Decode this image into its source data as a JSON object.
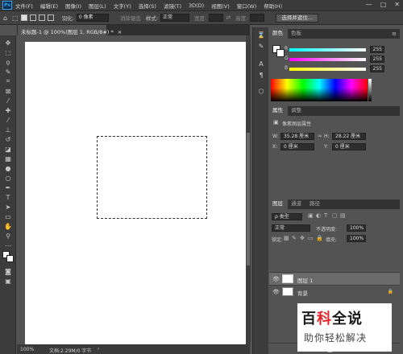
{
  "menubar": {
    "logo": "Ps",
    "items": [
      "文件(F)",
      "编辑(E)",
      "图像(I)",
      "图层(L)",
      "文字(Y)",
      "选择(S)",
      "滤镜(T)",
      "3D(D)",
      "视图(V)",
      "窗口(W)",
      "帮助(H)"
    ],
    "window_buttons": [
      "—",
      "□",
      "✕"
    ]
  },
  "options_bar": {
    "feather_label": "羽化:",
    "feather_value": "0 像素",
    "antialias_label": "消除锯齿",
    "style_label": "样式:",
    "style_value": "正常",
    "width_label": "宽度:",
    "height_label": "高度:",
    "select_mask_button": "选择并遮住..."
  },
  "document_tab": {
    "title": "未标题-1 @ 100%(图层 1, RGB/8#) *",
    "close": "×"
  },
  "status_bar": {
    "zoom": "100%",
    "doc_info": "文档:2.29M/0 字节"
  },
  "color_panel": {
    "tabs": [
      "颜色",
      "色板"
    ],
    "channels": [
      {
        "key": "R",
        "value": "255"
      },
      {
        "key": "G",
        "value": "255"
      },
      {
        "key": "B",
        "value": "255"
      }
    ]
  },
  "properties_panel": {
    "tabs": [
      "属性",
      "调整"
    ],
    "section_title": "像素图层属性",
    "w_label": "W:",
    "w_value": "35.28 厘米",
    "h_label": "H:",
    "h_value": "28.22 厘米",
    "x_label": "X:",
    "x_value": "0 厘米",
    "y_label": "Y:",
    "y_value": "0 厘米"
  },
  "layers_panel": {
    "tabs": [
      "图层",
      "通道",
      "路径"
    ],
    "filter_label": "ρ 类型",
    "blend_mode": "正常",
    "opacity_label": "不透明度:",
    "opacity_value": "100%",
    "lock_label": "锁定:",
    "fill_label": "填充:",
    "fill_value": "100%",
    "layers": [
      {
        "name": "图层 1",
        "selected": true
      },
      {
        "name": "背景",
        "selected": false
      }
    ]
  },
  "watermark": {
    "main_1": "百",
    "main_2": "科",
    "main_3": "全说",
    "sub": "助你轻松解决"
  },
  "colors": {
    "accent": "#31a8ff",
    "selected_layer": "#6b6b6b",
    "watermark_red": "#e0252b"
  }
}
